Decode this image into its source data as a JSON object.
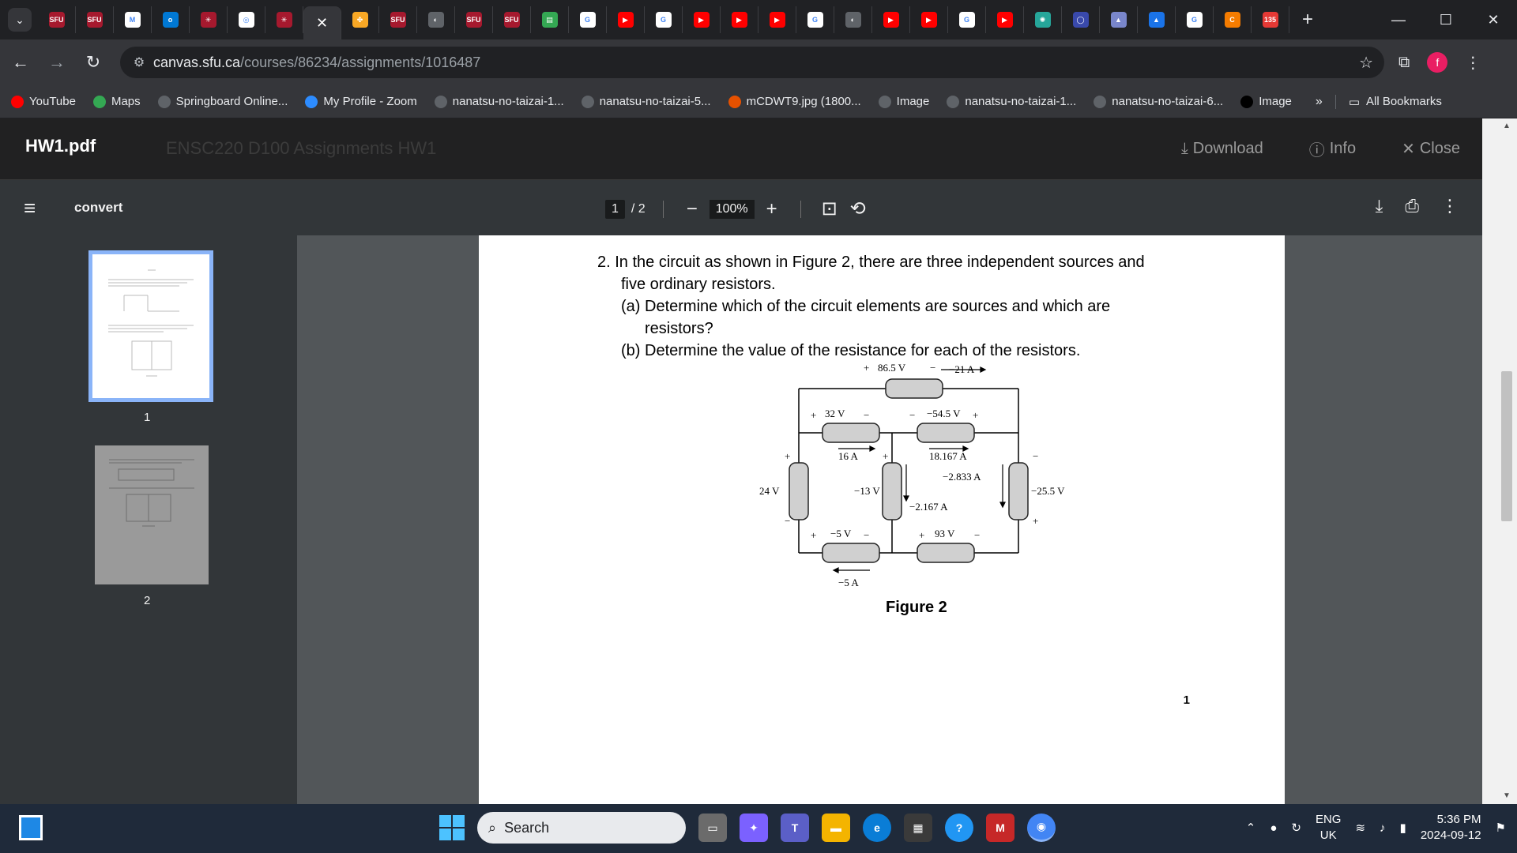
{
  "browser": {
    "tab_favicons": [
      {
        "label": "SFU",
        "color": "#a6192e"
      },
      {
        "label": "SFU",
        "color": "#a6192e"
      },
      {
        "label": "M",
        "color": "#ffffff"
      },
      {
        "label": "o",
        "color": "#0078d4"
      },
      {
        "label": "✳",
        "color": "#a6192e"
      },
      {
        "label": "◎",
        "color": "#ffffff"
      },
      {
        "label": "✳",
        "color": "#a6192e"
      },
      {
        "label": "✕",
        "color": "#35363a"
      },
      {
        "label": "✤",
        "color": "#f9a825"
      },
      {
        "label": "SFU",
        "color": "#a6192e"
      },
      {
        "label": "◐",
        "color": "#5f6368"
      },
      {
        "label": "SFU",
        "color": "#a6192e"
      },
      {
        "label": "SFU",
        "color": "#a6192e"
      },
      {
        "label": "▤",
        "color": "#34a853"
      },
      {
        "label": "G",
        "color": "#ffffff"
      },
      {
        "label": "▶",
        "color": "#ff0000"
      },
      {
        "label": "G",
        "color": "#ffffff"
      },
      {
        "label": "▶",
        "color": "#ff0000"
      },
      {
        "label": "▶",
        "color": "#ff0000"
      },
      {
        "label": "▶",
        "color": "#ff0000"
      },
      {
        "label": "G",
        "color": "#ffffff"
      },
      {
        "label": "◐",
        "color": "#5f6368"
      },
      {
        "label": "▶",
        "color": "#ff0000"
      },
      {
        "label": "▶",
        "color": "#ff0000"
      },
      {
        "label": "G",
        "color": "#ffffff"
      },
      {
        "label": "▶",
        "color": "#ff0000"
      },
      {
        "label": "✺",
        "color": "#26a69a"
      },
      {
        "label": "◯",
        "color": "#3949ab"
      },
      {
        "label": "▲",
        "color": "#7986cb"
      },
      {
        "label": "▲",
        "color": "#1a73e8"
      },
      {
        "label": "G",
        "color": "#ffffff"
      },
      {
        "label": "C",
        "color": "#f57c00"
      },
      {
        "label": "135",
        "color": "#e53935"
      }
    ],
    "new_tab": "+",
    "window_controls": {
      "minimize": "—",
      "maximize": "☐",
      "close": "✕"
    },
    "url_host": "canvas.sfu.ca",
    "url_path": "/courses/86234/assignments/1016487",
    "profile_initial": "f",
    "bookmarks": [
      {
        "label": "YouTube",
        "icon": "youtube-icon",
        "color": "#ff0000"
      },
      {
        "label": "Maps",
        "icon": "maps-icon",
        "color": "#34a853"
      },
      {
        "label": "Springboard Online...",
        "icon": "globe-icon",
        "color": "#5f6368"
      },
      {
        "label": "My Profile - Zoom",
        "icon": "zoom-icon",
        "color": "#2d8cff"
      },
      {
        "label": "nanatsu-no-taizai-1...",
        "icon": "globe-icon",
        "color": "#5f6368"
      },
      {
        "label": "nanatsu-no-taizai-5...",
        "icon": "globe-icon",
        "color": "#5f6368"
      },
      {
        "label": "mCDWT9.jpg (1800...",
        "icon": "image-icon",
        "color": "#e65100"
      },
      {
        "label": "Image",
        "icon": "globe-icon",
        "color": "#5f6368"
      },
      {
        "label": "nanatsu-no-taizai-1...",
        "icon": "globe-icon",
        "color": "#5f6368"
      },
      {
        "label": "nanatsu-no-taizai-6...",
        "icon": "globe-icon",
        "color": "#5f6368"
      },
      {
        "label": "Image",
        "icon": "x-icon",
        "color": "#000000"
      }
    ],
    "bookmarks_more": "»",
    "all_bookmarks": "All Bookmarks"
  },
  "canvas": {
    "file_title": "HW1.pdf",
    "ghost_breadcrumb": "ENSC220 D100   Assignments   HW1",
    "download_label": "Download",
    "info_label": "Info",
    "close_label": "Close"
  },
  "pdf": {
    "doc_title": "convert",
    "current_page": "1",
    "total_pages": "/  2",
    "zoom": "100%",
    "thumb_labels": [
      "1",
      "2"
    ],
    "page_number": "1",
    "question": {
      "line1": "2.  In the circuit as shown in Figure 2, there are three independent sources and",
      "line2": "five ordinary resistors.",
      "line3": "(a) Determine which of the circuit elements are sources and which are",
      "line4": "resistors?",
      "line5": "(b) Determine the value of the resistance for each of the resistors."
    },
    "figure_caption": "Figure 2",
    "circuit_labels": {
      "top_v": "86.5 V",
      "top_i": "−21 A",
      "l_v": "32 V",
      "r_v": "−54.5 V",
      "l_i": "16 A",
      "r_i": "18.167 A",
      "mid_i": "−2.833 A",
      "left_src": "24 V",
      "center_v": "−13 V",
      "center_i": "−2.167 A",
      "right_v": "−25.5 V",
      "bl_v": "−5 V",
      "br_v": "93 V",
      "bl_i": "−5 A"
    }
  },
  "taskbar": {
    "search_placeholder": "Search",
    "language_top": "ENG",
    "language_bottom": "UK",
    "time": "5:36 PM",
    "date": "2024-09-12"
  }
}
